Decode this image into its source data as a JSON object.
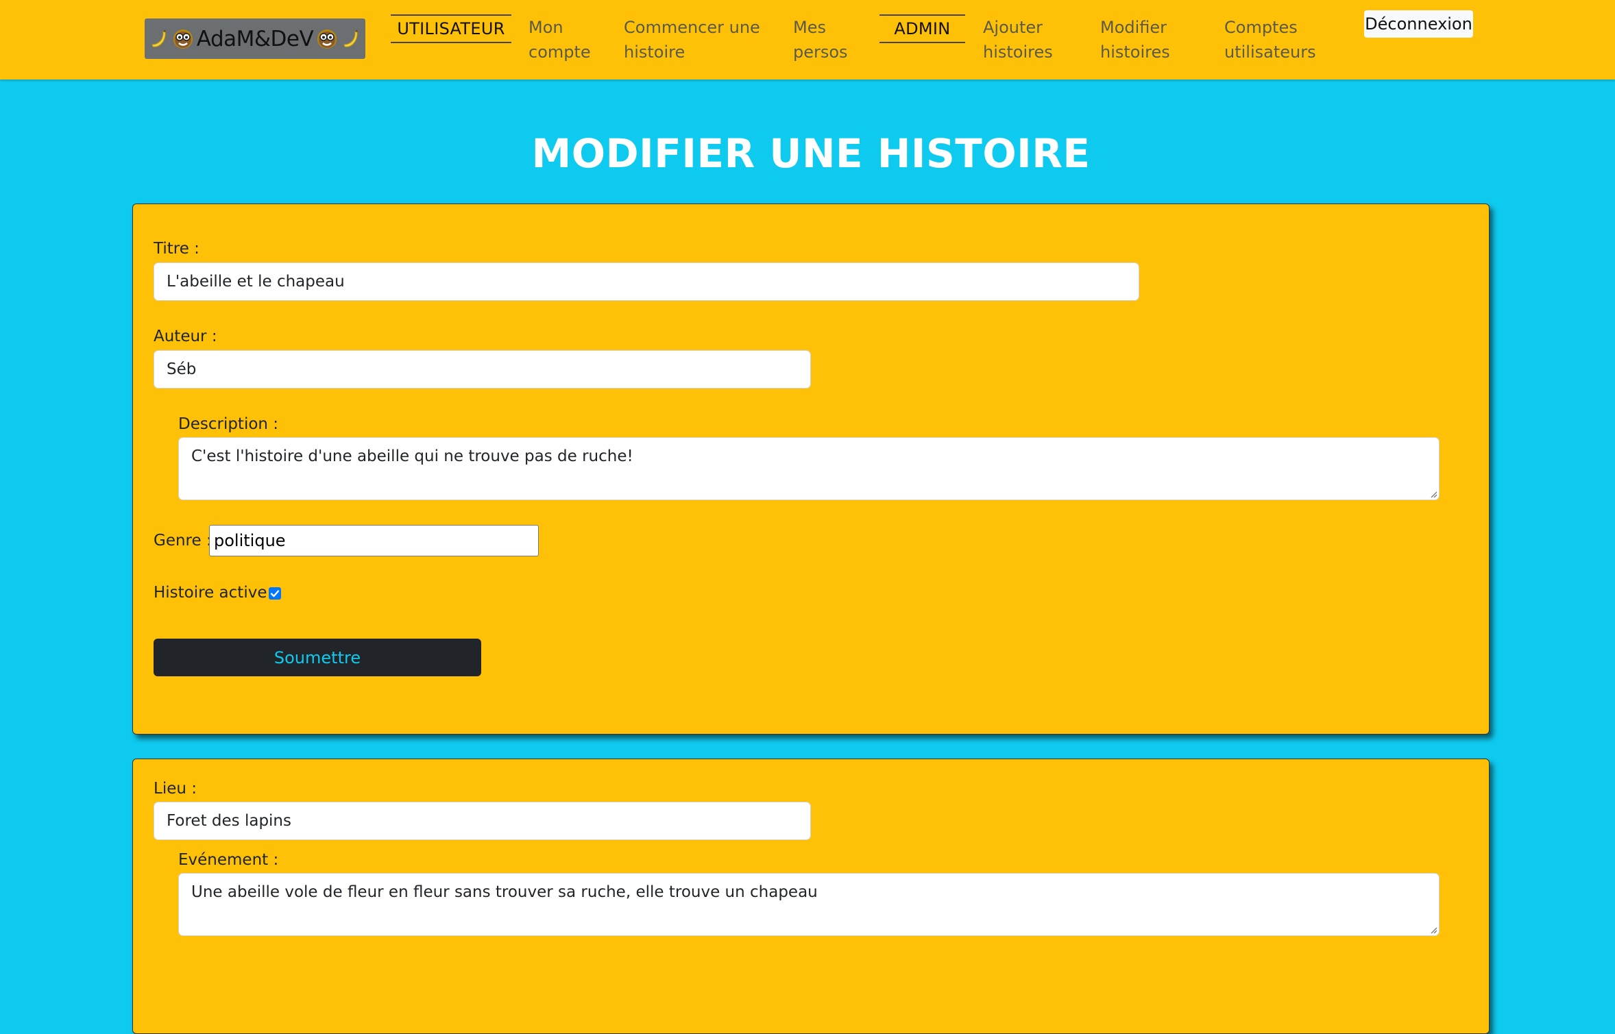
{
  "navbar": {
    "brand": {
      "text": "AdaM&DeV",
      "left_emoji": "banana",
      "right_emoji": "banana",
      "face_icon": "nerd-face"
    },
    "user_heading": "UTILISATEUR",
    "admin_heading": "ADMIN",
    "links": {
      "mon_compte_1": "Mon",
      "mon_compte_2": "compte",
      "commencer_1": "Commencer une",
      "commencer_2": "histoire",
      "mes_persos_1": "Mes",
      "mes_persos_2": "persos",
      "ajouter_1": "Ajouter",
      "ajouter_2": "histoires",
      "modifier_1": "Modifier",
      "modifier_2": "histoires",
      "comptes_1": "Comptes",
      "comptes_2": "utilisateurs"
    },
    "logout_label": "Déconnexion"
  },
  "page_title": "MODIFIER UNE HISTOIRE",
  "story_form": {
    "titre_label": "Titre :",
    "titre_value": "L'abeille et le chapeau",
    "auteur_label": "Auteur :",
    "auteur_value": "Séb",
    "description_label": "Description :",
    "description_value": "C'est l'histoire d'une abeille qui ne trouve pas de ruche!",
    "genre_label": "Genre :",
    "genre_value": "politique",
    "active_label": "Histoire active :",
    "active_checked": true,
    "submit_label": "Soumettre"
  },
  "event_form": {
    "lieu_label": "Lieu :",
    "lieu_value": "Foret des lapins",
    "evenement_label": "Evénement :",
    "evenement_value": "Une abeille vole de fleur en fleur sans trouver sa ruche, elle trouve un chapeau"
  },
  "colors": {
    "background": "#0fcaef",
    "navbar": "#ffc107",
    "card": "#ffc107",
    "submit_bg": "#212529",
    "submit_text": "#0fcaef",
    "title": "#ffffff"
  }
}
